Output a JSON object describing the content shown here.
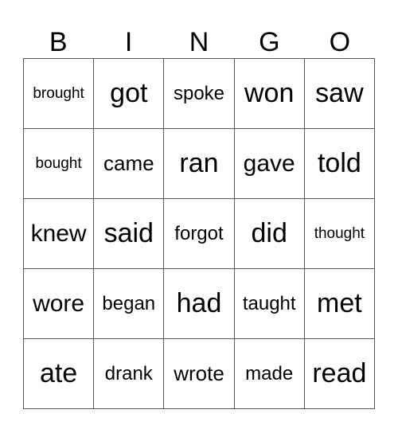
{
  "header": [
    "B",
    "I",
    "N",
    "G",
    "O"
  ],
  "rows": [
    [
      {
        "word": "brought",
        "size": "s-xs"
      },
      {
        "word": "got",
        "size": "s-xl"
      },
      {
        "word": "spoke",
        "size": "s-s"
      },
      {
        "word": "won",
        "size": "s-xl"
      },
      {
        "word": "saw",
        "size": "s-xl"
      }
    ],
    [
      {
        "word": "bought",
        "size": "s-xs"
      },
      {
        "word": "came",
        "size": "s-m"
      },
      {
        "word": "ran",
        "size": "s-xl"
      },
      {
        "word": "gave",
        "size": "s-l"
      },
      {
        "word": "told",
        "size": "s-xl"
      }
    ],
    [
      {
        "word": "knew",
        "size": "s-l"
      },
      {
        "word": "said",
        "size": "s-xl"
      },
      {
        "word": "forgot",
        "size": "s-s"
      },
      {
        "word": "did",
        "size": "s-xl"
      },
      {
        "word": "thought",
        "size": "s-xs"
      }
    ],
    [
      {
        "word": "wore",
        "size": "s-l"
      },
      {
        "word": "began",
        "size": "s-s"
      },
      {
        "word": "had",
        "size": "s-xl"
      },
      {
        "word": "taught",
        "size": "s-s"
      },
      {
        "word": "met",
        "size": "s-xl"
      }
    ],
    [
      {
        "word": "ate",
        "size": "s-xl"
      },
      {
        "word": "drank",
        "size": "s-s"
      },
      {
        "word": "wrote",
        "size": "s-m"
      },
      {
        "word": "made",
        "size": "s-s"
      },
      {
        "word": "read",
        "size": "s-xl"
      }
    ]
  ]
}
